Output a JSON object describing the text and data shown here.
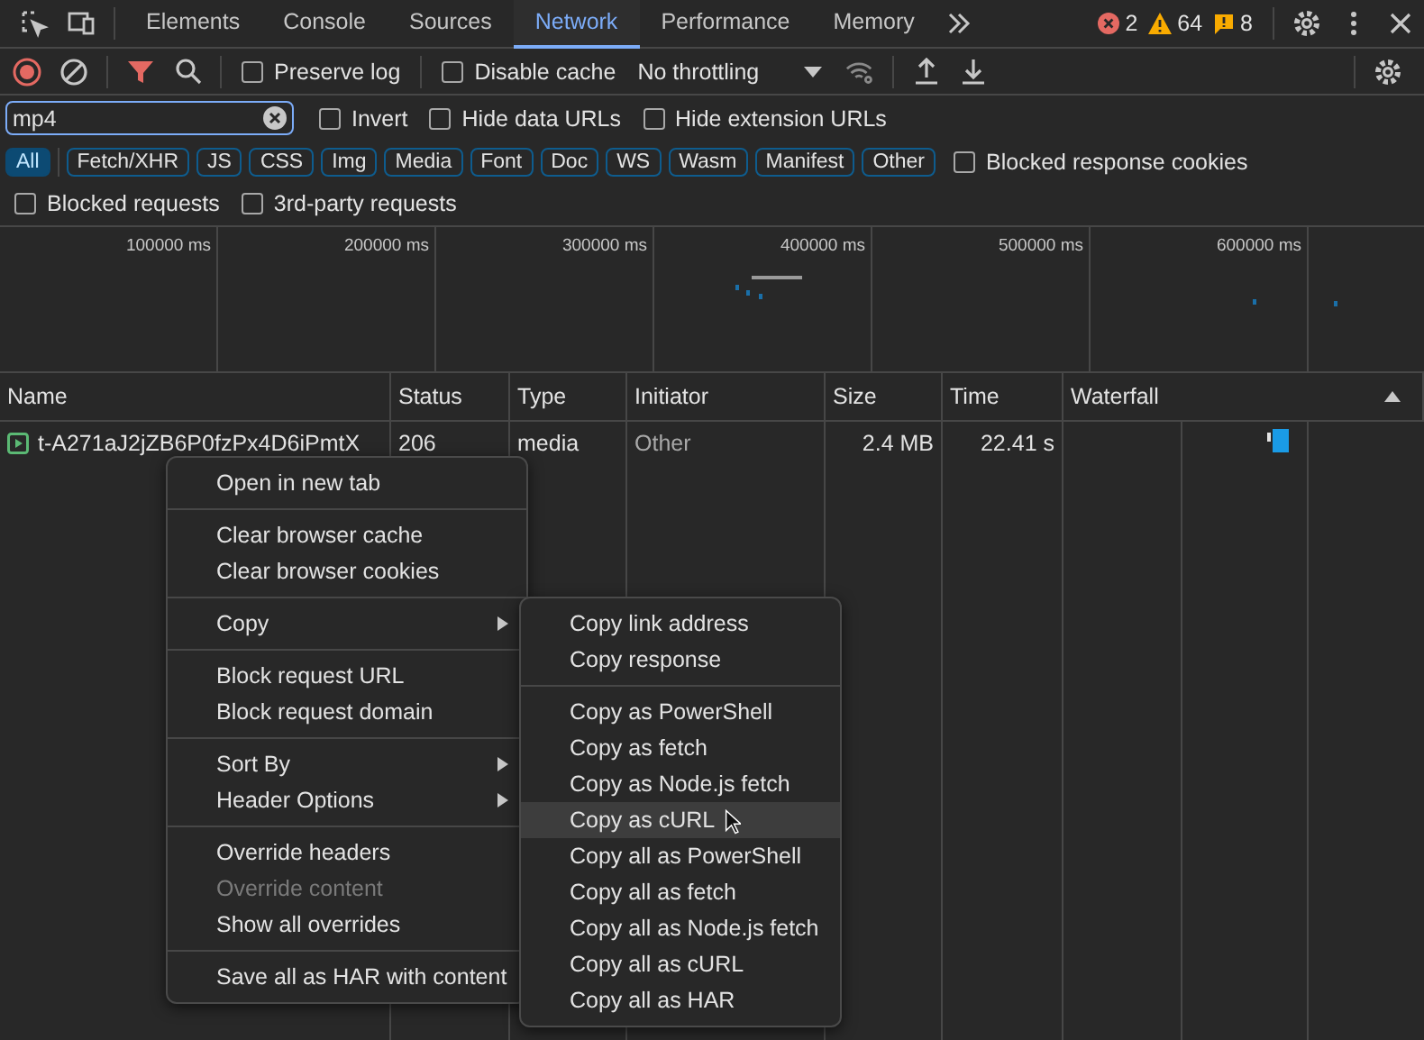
{
  "main_tabs": [
    {
      "label": "Elements",
      "selected": false
    },
    {
      "label": "Console",
      "selected": false
    },
    {
      "label": "Sources",
      "selected": false
    },
    {
      "label": "Network",
      "selected": true
    },
    {
      "label": "Performance",
      "selected": false
    },
    {
      "label": "Memory",
      "selected": false
    }
  ],
  "counts": {
    "errors": "2",
    "warnings": "64",
    "issues": "8"
  },
  "toolbar": {
    "recording": true,
    "preserve_log": {
      "label": "Preserve log",
      "checked": false
    },
    "disable_cache": {
      "label": "Disable cache",
      "checked": false
    },
    "throttling": "No throttling"
  },
  "filter": {
    "value": "mp4",
    "options": [
      {
        "label": "Invert",
        "checked": false
      },
      {
        "label": "Hide data URLs",
        "checked": false
      },
      {
        "label": "Hide extension URLs",
        "checked": false
      }
    ]
  },
  "types": [
    {
      "label": "All",
      "selected": true
    },
    {
      "label": "Fetch/XHR",
      "selected": false
    },
    {
      "label": "JS",
      "selected": false
    },
    {
      "label": "CSS",
      "selected": false
    },
    {
      "label": "Img",
      "selected": false
    },
    {
      "label": "Media",
      "selected": false
    },
    {
      "label": "Font",
      "selected": false
    },
    {
      "label": "Doc",
      "selected": false
    },
    {
      "label": "WS",
      "selected": false
    },
    {
      "label": "Wasm",
      "selected": false
    },
    {
      "label": "Manifest",
      "selected": false
    },
    {
      "label": "Other",
      "selected": false
    }
  ],
  "type_options": [
    {
      "label": "Blocked response cookies",
      "checked": false
    }
  ],
  "more_options": [
    {
      "label": "Blocked requests",
      "checked": false
    },
    {
      "label": "3rd-party requests",
      "checked": false
    }
  ],
  "overview_ticks": [
    "100000 ms",
    "200000 ms",
    "300000 ms",
    "400000 ms",
    "500000 ms",
    "600000 ms"
  ],
  "table": {
    "columns": [
      "Name",
      "Status",
      "Type",
      "Initiator",
      "Size",
      "Time",
      "Waterfall"
    ],
    "rows": [
      {
        "name": "t-A271aJ2jZB6P0fzPx4D6iPmtX",
        "status": "206",
        "type": "media",
        "initiator": "Other",
        "size": "2.4 MB",
        "time": "22.41 s"
      }
    ]
  },
  "context_menu": {
    "groups": [
      [
        {
          "label": "Open in new tab",
          "submenu": false,
          "disabled": false
        }
      ],
      [
        {
          "label": "Clear browser cache",
          "submenu": false,
          "disabled": false
        },
        {
          "label": "Clear browser cookies",
          "submenu": false,
          "disabled": false
        }
      ],
      [
        {
          "label": "Copy",
          "submenu": true,
          "disabled": false
        }
      ],
      [
        {
          "label": "Block request URL",
          "submenu": false,
          "disabled": false
        },
        {
          "label": "Block request domain",
          "submenu": false,
          "disabled": false
        }
      ],
      [
        {
          "label": "Sort By",
          "submenu": true,
          "disabled": false
        },
        {
          "label": "Header Options",
          "submenu": true,
          "disabled": false
        }
      ],
      [
        {
          "label": "Override headers",
          "submenu": false,
          "disabled": false
        },
        {
          "label": "Override content",
          "submenu": false,
          "disabled": true
        },
        {
          "label": "Show all overrides",
          "submenu": false,
          "disabled": false
        }
      ],
      [
        {
          "label": "Save all as HAR with content",
          "submenu": false,
          "disabled": false
        }
      ]
    ]
  },
  "copy_submenu": {
    "groups": [
      [
        {
          "label": "Copy link address",
          "selected": false
        },
        {
          "label": "Copy response",
          "selected": false
        }
      ],
      [
        {
          "label": "Copy as PowerShell",
          "selected": false
        },
        {
          "label": "Copy as fetch",
          "selected": false
        },
        {
          "label": "Copy as Node.js fetch",
          "selected": false
        },
        {
          "label": "Copy as cURL",
          "selected": true
        },
        {
          "label": "Copy all as PowerShell",
          "selected": false
        },
        {
          "label": "Copy all as fetch",
          "selected": false
        },
        {
          "label": "Copy all as Node.js fetch",
          "selected": false
        },
        {
          "label": "Copy all as cURL",
          "selected": false
        },
        {
          "label": "Copy all as HAR",
          "selected": false
        }
      ]
    ]
  }
}
